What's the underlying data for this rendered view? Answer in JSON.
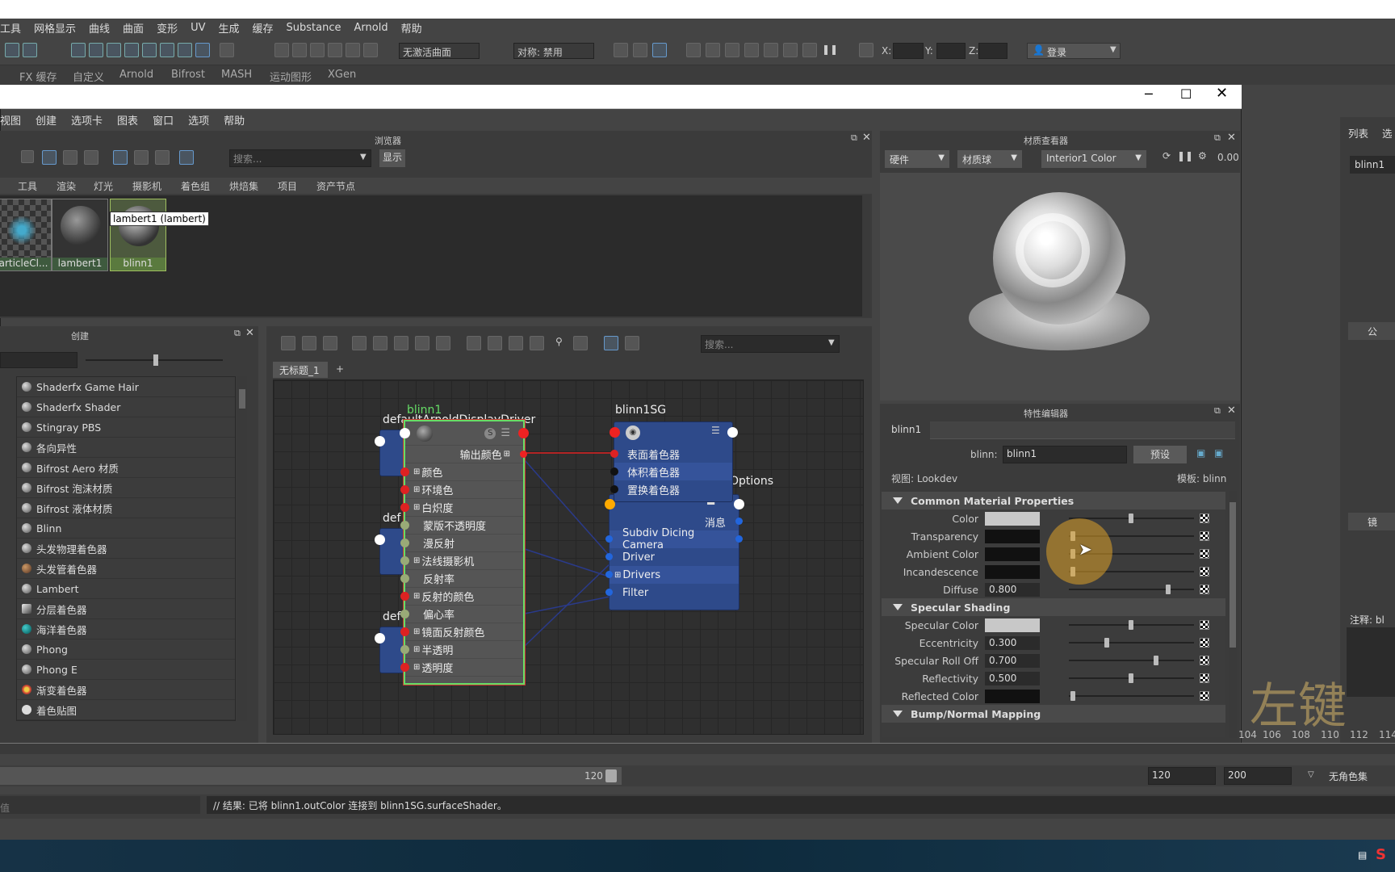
{
  "menubar": [
    "工具",
    "网格显示",
    "曲线",
    "曲面",
    "变形",
    "UV",
    "生成",
    "缓存",
    "Substance",
    "Arnold",
    "帮助"
  ],
  "toolbar": {
    "no_live_surface": "无激活曲面",
    "symmetry": "对称: 禁用",
    "x_label": "X:",
    "y_label": "Y:",
    "z_label": "Z:",
    "login": "登录"
  },
  "shelf_tabs": [
    "FX 缓存",
    "自定义",
    "Arnold",
    "Bifrost",
    "MASH",
    "运动图形",
    "XGen"
  ],
  "hypershade": {
    "menu": [
      "视图",
      "创建",
      "选项卡",
      "图表",
      "窗口",
      "选项",
      "帮助"
    ],
    "browser": {
      "title": "浏览器",
      "search_placeholder": "搜索...",
      "show_button": "显示",
      "tabs": [
        "工具",
        "渲染",
        "灯光",
        "摄影机",
        "着色组",
        "烘焙集",
        "项目",
        "资产节点"
      ],
      "swatches": [
        {
          "label": "articleCl...",
          "selected": false
        },
        {
          "label": "lambert1",
          "selected": false
        },
        {
          "label": "blinn1",
          "selected": true
        }
      ],
      "tooltip": "lambert1 (lambert)"
    },
    "create": {
      "title": "创建",
      "items": [
        "Shaderfx Game Hair",
        "Shaderfx Shader",
        "Stingray PBS",
        "各向异性",
        "Bifrost Aero 材质",
        "Bifrost 泡沫材质",
        "Bifrost 液体材质",
        "Blinn",
        "头发物理着色器",
        "头发管着色器",
        "Lambert",
        "分层着色器",
        "海洋着色器",
        "Phong",
        "Phong E",
        "渐变着色器",
        "着色贴图"
      ]
    },
    "graph": {
      "search_placeholder": "搜索...",
      "tab": "无标题_1",
      "add_tab": "+",
      "blinn_node": {
        "name": "blinn1",
        "overlap_label": "defaultArnoldDisplayDriver",
        "output": "输出颜色",
        "attrs": [
          "颜色",
          "环境色",
          "白炽度",
          "蒙版不透明度",
          "漫反射",
          "法线摄影机",
          "反射率",
          "反射的颜色",
          "偏心率",
          "镜面反射颜色",
          "半透明",
          "透明度"
        ]
      },
      "left_partial_labels": [
        "def",
        "def"
      ],
      "sg_node": {
        "name": "blinn1SG",
        "attrs": [
          "表面着色器",
          "体积着色器",
          "置换着色器"
        ]
      },
      "options_node": {
        "label": "Options",
        "attrs": [
          "消息",
          "Subdiv Dicing Camera",
          "Driver",
          "Drivers",
          "Filter"
        ]
      }
    },
    "viewer": {
      "title": "材质查看器",
      "renderer": "硬件",
      "shape": "材质球",
      "light": "Interior1 Color",
      "value": "0.00"
    },
    "attr_editor": {
      "title": "特性编辑器",
      "tab": "blinn1",
      "type_label": "blinn:",
      "name_value": "blinn1",
      "preset_button": "预设",
      "view_label": "视图: Lookdev",
      "template_label": "模板: blinn",
      "sections": [
        {
          "title": "Common Material Properties",
          "rows": [
            {
              "label": "Color",
              "value": "",
              "swatch": "#c8c8c8",
              "slider": 0.5
            },
            {
              "label": "Transparency",
              "value": "",
              "swatch": "#111111",
              "slider": 0.03
            },
            {
              "label": "Ambient Color",
              "value": "",
              "swatch": "#111111",
              "slider": 0.03
            },
            {
              "label": "Incandescence",
              "value": "",
              "swatch": "#111111",
              "slider": 0.03
            },
            {
              "label": "Diffuse",
              "value": "0.800",
              "swatch": "",
              "slider": 0.8
            }
          ]
        },
        {
          "title": "Specular Shading",
          "rows": [
            {
              "label": "Specular Color",
              "value": "",
              "swatch": "#c8c8c8",
              "slider": 0.5
            },
            {
              "label": "Eccentricity",
              "value": "0.300",
              "swatch": "",
              "slider": 0.3
            },
            {
              "label": "Specular Roll Off",
              "value": "0.700",
              "swatch": "",
              "slider": 0.7
            },
            {
              "label": "Reflectivity",
              "value": "0.500",
              "swatch": "",
              "slider": 0.5
            },
            {
              "label": "Reflected Color",
              "value": "",
              "swatch": "#111111",
              "slider": 0.03
            }
          ]
        },
        {
          "title": "Bump/Normal Mapping",
          "rows": []
        }
      ]
    }
  },
  "right_panel": {
    "tabs": [
      "列表",
      "选"
    ],
    "item": "blinn1",
    "sect1": "公",
    "sect2": "镜",
    "notes": "注释: bl"
  },
  "watermark": "左键",
  "timeline_ticks": [
    "104",
    "106",
    "108",
    "110",
    "112",
    "114"
  ],
  "range": {
    "current": "120",
    "start": "120",
    "end": "200",
    "char_set": "无角色集"
  },
  "command": {
    "label": "值",
    "result": "// 结果: 已将 blinn1.outColor 连接到 blinn1SG.surfaceShader。"
  }
}
